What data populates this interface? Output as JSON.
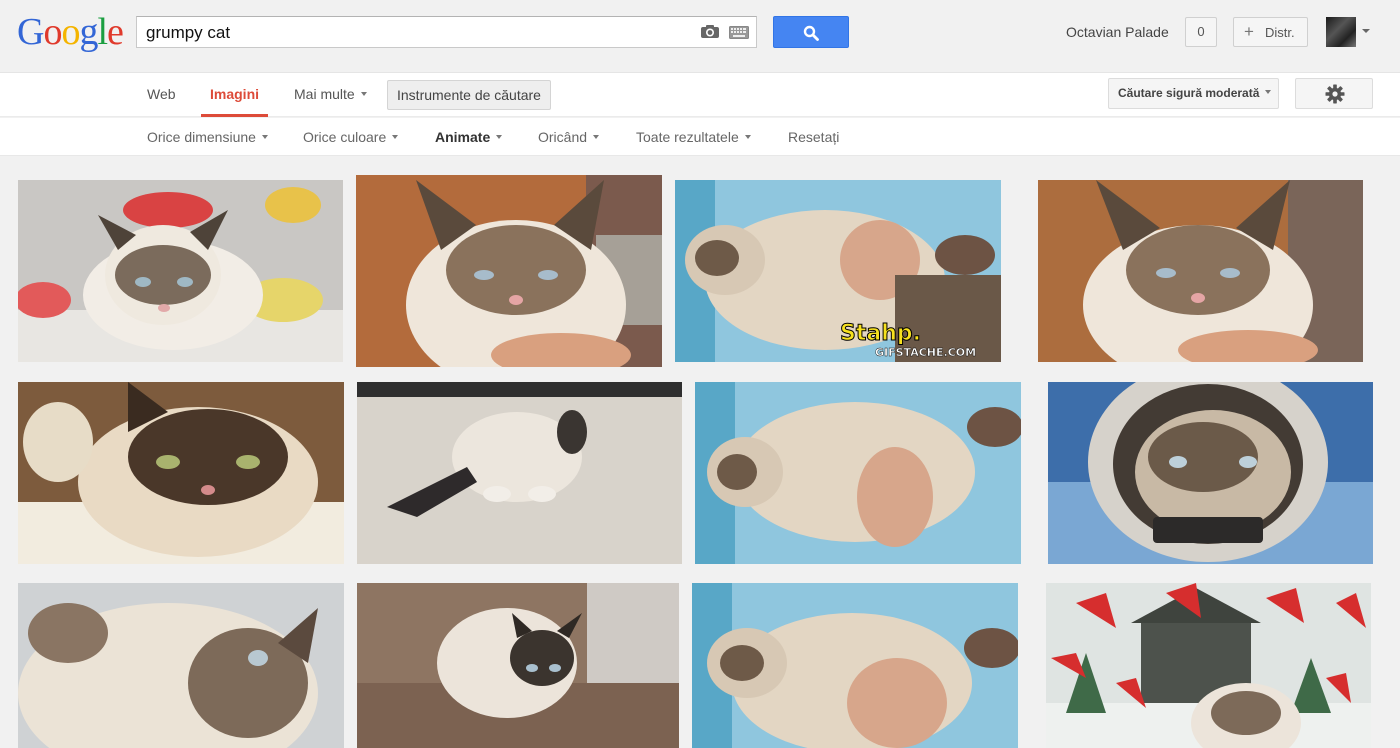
{
  "logo": "Google",
  "search": {
    "query": "grumpy cat"
  },
  "user": {
    "name": "Octavian Palade",
    "notifications": "0",
    "share_label": "Distr."
  },
  "tabs": {
    "web": "Web",
    "images": "Imagini",
    "more": "Mai multe",
    "tools": "Instrumente de căutare"
  },
  "safesearch": "Căutare sigură moderată",
  "filters": {
    "size": "Orice dimensiune",
    "color": "Orice culoare",
    "type": "Animate",
    "time": "Oricând",
    "results": "Toate rezultatele",
    "reset": "Resetați"
  },
  "overlay": {
    "caption": "Stahp.",
    "watermark": "GIFSTACHE.COM"
  },
  "colors": {
    "search_button": "#4585f2",
    "active_tab": "#dd4b39"
  }
}
